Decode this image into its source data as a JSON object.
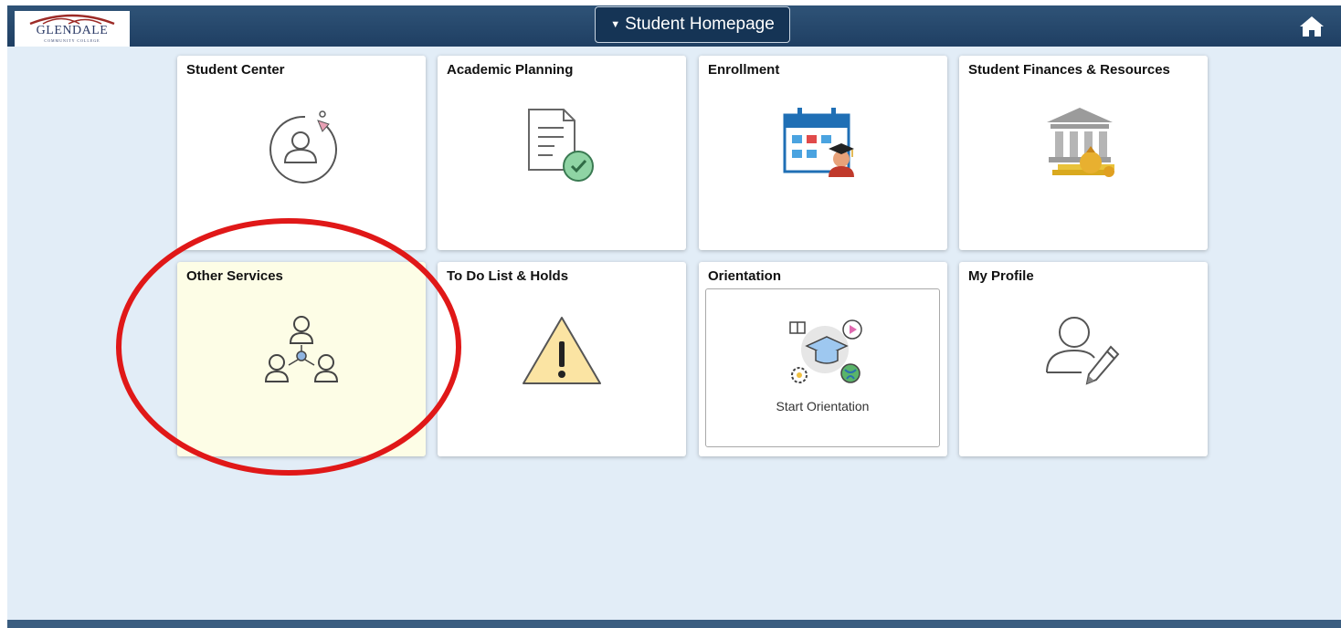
{
  "header": {
    "logo_text": "GLENDALE",
    "logo_subtext": "COMMUNITY COLLEGE",
    "homepage_label": "Student Homepage"
  },
  "tiles": [
    {
      "title": "Student Center",
      "icon": "student-center-icon"
    },
    {
      "title": "Academic Planning",
      "icon": "document-check-icon"
    },
    {
      "title": "Enrollment",
      "icon": "calendar-student-icon"
    },
    {
      "title": "Student Finances & Resources",
      "icon": "bank-coins-icon"
    },
    {
      "title": "Other Services",
      "icon": "people-network-icon"
    },
    {
      "title": "To Do List & Holds",
      "icon": "warning-icon"
    },
    {
      "title": "Orientation",
      "icon": "orientation-icon",
      "button_label": "Start Orientation"
    },
    {
      "title": "My Profile",
      "icon": "profile-edit-icon"
    }
  ],
  "colors": {
    "header": "#1f3f63",
    "background": "#e2edf7",
    "highlight_tile": "#fdfde6",
    "annotation": "#e01818"
  }
}
